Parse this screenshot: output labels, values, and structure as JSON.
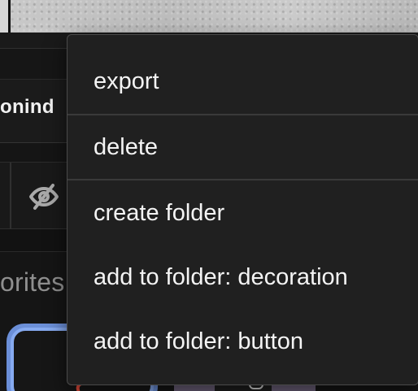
{
  "background": {
    "visible_label": "onind",
    "section_label": "orites"
  },
  "context_menu": {
    "items": [
      {
        "label": "export"
      },
      {
        "label": "delete"
      },
      {
        "label": "create folder"
      },
      {
        "label": "add to folder: decoration"
      },
      {
        "label": "add to folder: button"
      }
    ]
  },
  "icons": {
    "visibility": "eye-off-icon"
  },
  "colors": {
    "menu_background": "#202020",
    "menu_border": "#4a4a4a",
    "tile_accent": "#86aaf0",
    "warning_mark": "#e14b3b"
  }
}
